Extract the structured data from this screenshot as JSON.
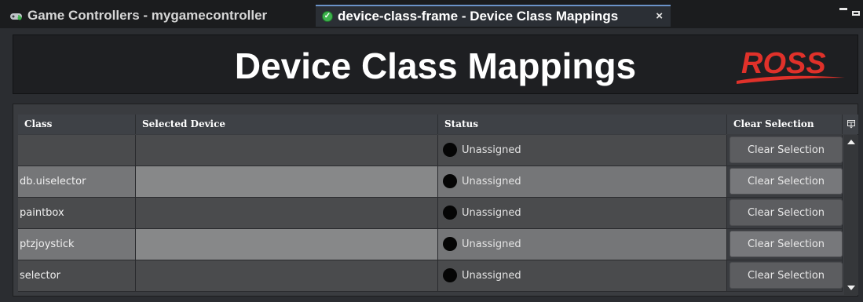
{
  "tabs": [
    {
      "label": "Game Controllers - mygamecontroller",
      "icon": "gamepad-icon",
      "active": false
    },
    {
      "label": "device-class-frame - Device Class Mappings",
      "icon": "check-circle-icon",
      "active": true,
      "close": "×"
    }
  ],
  "header": {
    "title": "Device Class Mappings",
    "logo_text": "ROSS",
    "logo_color": "#e0312a"
  },
  "table": {
    "columns": [
      "Class",
      "Selected Device",
      "Status",
      "Clear Selection"
    ],
    "rows": [
      {
        "class": "",
        "selected_device": "",
        "status": "Unassigned",
        "button": "Clear Selection"
      },
      {
        "class": "db.uiselector",
        "selected_device": "",
        "status": "Unassigned",
        "button": "Clear Selection"
      },
      {
        "class": "paintbox",
        "selected_device": "",
        "status": "Unassigned",
        "button": "Clear Selection"
      },
      {
        "class": "ptzjoystick",
        "selected_device": "",
        "status": "Unassigned",
        "button": "Clear Selection"
      },
      {
        "class": "selector",
        "selected_device": "",
        "status": "Unassigned",
        "button": "Clear Selection"
      }
    ]
  },
  "colors": {
    "status_unassigned": "#050505",
    "active_tab_border": "#6b93c9"
  }
}
